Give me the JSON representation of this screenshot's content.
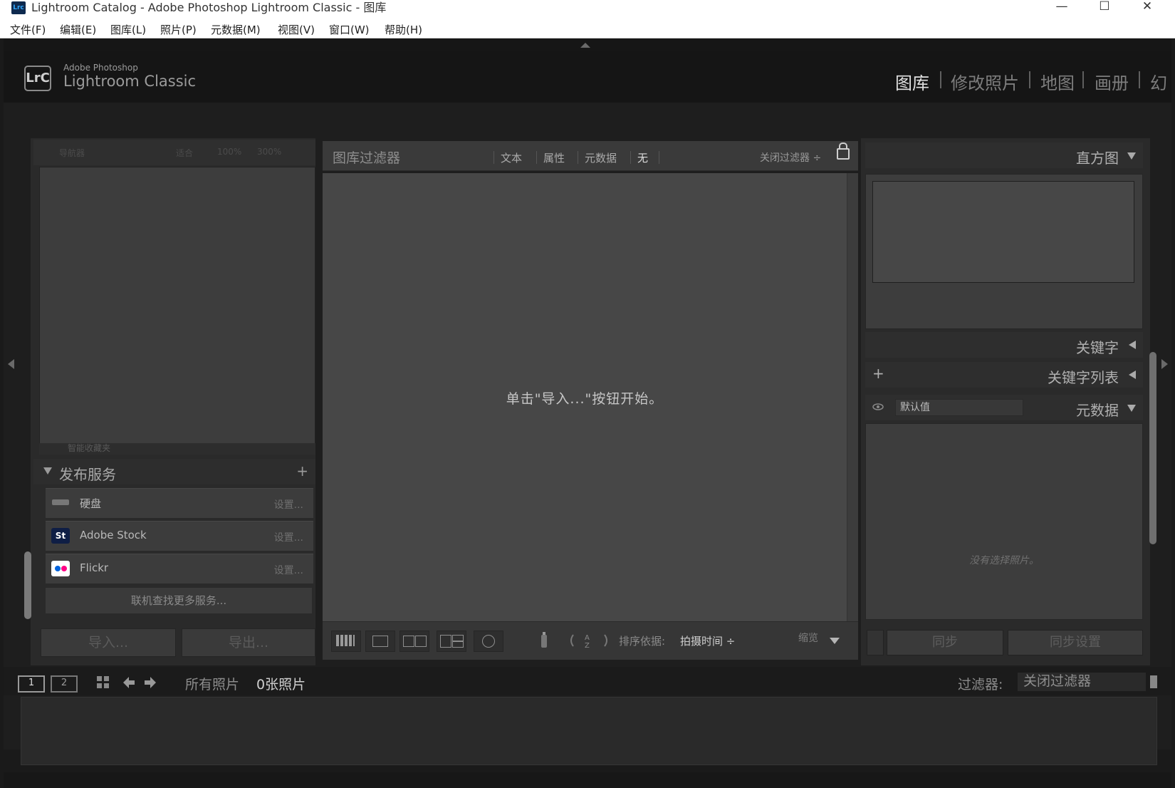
{
  "window": {
    "app_icon": "Lrc",
    "title": "Lightroom Catalog - Adobe Photoshop Lightroom Classic - 图库",
    "minimize": "—",
    "maximize": "☐",
    "close": "✕"
  },
  "menu": [
    "文件(F)",
    "编辑(E)",
    "图库(L)",
    "照片(P)",
    "元数据(M)",
    "视图(V)",
    "窗口(W)",
    "帮助(H)"
  ],
  "identity": {
    "logo": "LrC",
    "line1": "Adobe Photoshop",
    "line2": "Lightroom Classic"
  },
  "modules": [
    "图库",
    "修改照片",
    "地图",
    "画册",
    "幻"
  ],
  "navigator": {
    "title": "导航器",
    "zoom_options": [
      "适合",
      "100%",
      "300%"
    ]
  },
  "collections_stub": "智能收藏夹",
  "publish": {
    "title": "发布服务",
    "add": "+",
    "services": [
      {
        "icon": "",
        "name": "硬盘",
        "setup": "设置..."
      },
      {
        "icon": "St",
        "name": "Adobe Stock",
        "setup": "设置..."
      },
      {
        "icon": "●●",
        "name": "Flickr",
        "setup": "设置..."
      }
    ],
    "more": "联机查找更多服务..."
  },
  "left_buttons": {
    "import": "导入...",
    "export": "导出..."
  },
  "filter_bar": {
    "title": "图库过滤器",
    "tabs": [
      "文本",
      "属性",
      "元数据",
      "无"
    ],
    "preset": "关闭过滤器 ÷"
  },
  "grid": {
    "empty_message": "单击\"导入...\"按钮开始。"
  },
  "toolbar": {
    "sort_label": "排序依据:",
    "sort_value": "拍摄时间 ÷",
    "thumb_label": "缩览"
  },
  "right": {
    "histogram": "直方图",
    "keywording": "关键字",
    "keyword_list": "关键字列表",
    "keyword_list_add": "+",
    "metadata_preset": "默认值",
    "metadata": "元数据",
    "metadata_empty": "没有选择照片。",
    "sync": "同步",
    "sync_settings": "同步设置"
  },
  "filmstrip": {
    "monitor1": "1",
    "monitor2": "2",
    "source": "所有照片",
    "count": "0张照片",
    "filter_label": "过滤器:",
    "filter_value": "关闭过滤器"
  },
  "colors": {
    "accent": "#31a8ff",
    "stock": "#0f1e45",
    "flickr_pink": "#ff0084",
    "flickr_blue": "#0063dc"
  }
}
